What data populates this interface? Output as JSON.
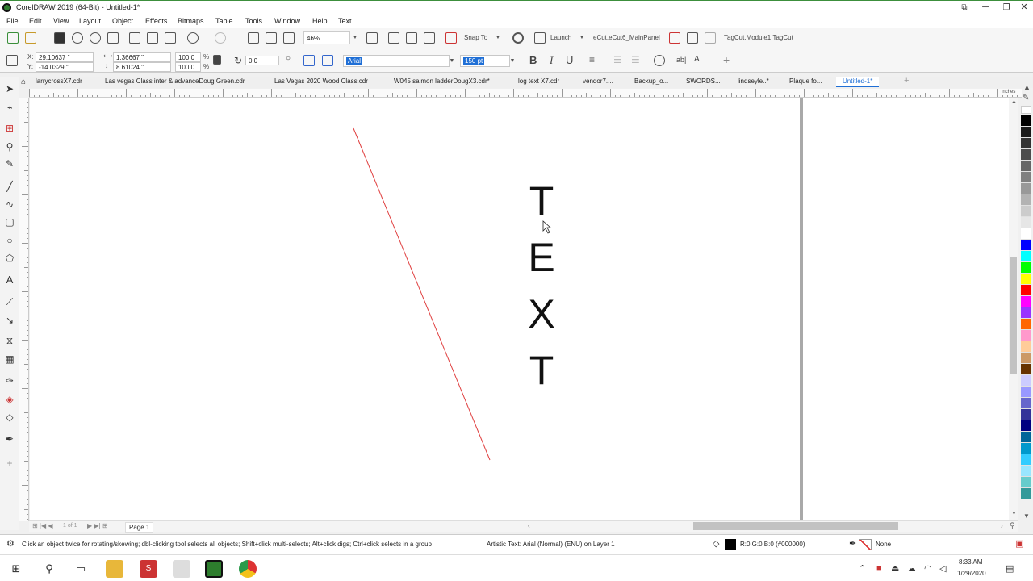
{
  "window": {
    "title": "CorelDRAW 2019 (64-Bit) - Untitled-1*"
  },
  "menu": [
    "File",
    "Edit",
    "View",
    "Layout",
    "Object",
    "Effects",
    "Bitmaps",
    "Table",
    "Tools",
    "Window",
    "Help",
    "Text"
  ],
  "toolbar": {
    "zoom": "46%",
    "snap_to": "Snap To",
    "launch": "Launch",
    "ecut_panel": "eCut.eCut6_MainPanel",
    "tagcut": "TagCut.Module1.TagCut"
  },
  "propbar": {
    "x": "29.10637 \"",
    "y": "-14.0329 \"",
    "w": "1.36667 \"",
    "h": "8.61024 \"",
    "sx": "100.0",
    "sy": "100.0",
    "angle": "0.0",
    "font": "Arial",
    "size": "150 pt",
    "bold": "B",
    "italic": "I",
    "underline": "U"
  },
  "tabs": [
    "larrycrossX7.cdr",
    "Las vegas Class inter & advanceDoug Green.cdr",
    "Las Vegas 2020 Wood Class.cdr",
    "W045 salmon ladderDougX3.cdr*",
    "log text X7.cdr",
    "vendor7....",
    "Backup_o...",
    "SWORDS...",
    "lindseyle..*",
    "Plaque fo...",
    "Untitled-1*"
  ],
  "canvas": {
    "letters": [
      "T",
      "E",
      "X",
      "T"
    ],
    "ruler_units": "inches",
    "line_color": "#e04040"
  },
  "pager": {
    "counter": "1 of 1",
    "page_tab": "Page 1"
  },
  "palette": [
    "#000000",
    "#1a1a1a",
    "#333333",
    "#4d4d4d",
    "#666666",
    "#808080",
    "#999999",
    "#b3b3b3",
    "#cccccc",
    "#e6e6e6",
    "#ffffff",
    "#0000ff",
    "#00ffff",
    "#00ff00",
    "#ffff00",
    "#ff0000",
    "#ff00ff",
    "#9933ff",
    "#ff6600",
    "#ff99cc",
    "#ffcc99",
    "#cc9966",
    "#663300",
    "#ccccff",
    "#9999ff",
    "#6666cc",
    "#333399",
    "#000080",
    "#006699",
    "#0099cc",
    "#33ccff",
    "#99e6ff",
    "#66cccc",
    "#339999"
  ],
  "status": {
    "hint": "Click an object twice for rotating/skewing; dbl-clicking tool selects all objects; Shift+click multi-selects; Alt+click digs; Ctrl+click selects in a group",
    "object_info": "Artistic Text: Arial (Normal) (ENU) on Layer 1",
    "fill": "R:0 G:0 B:0 (#000000)",
    "outline": "None"
  },
  "taskbar": {
    "time": "8:33 AM",
    "date": "1/29/2020"
  }
}
